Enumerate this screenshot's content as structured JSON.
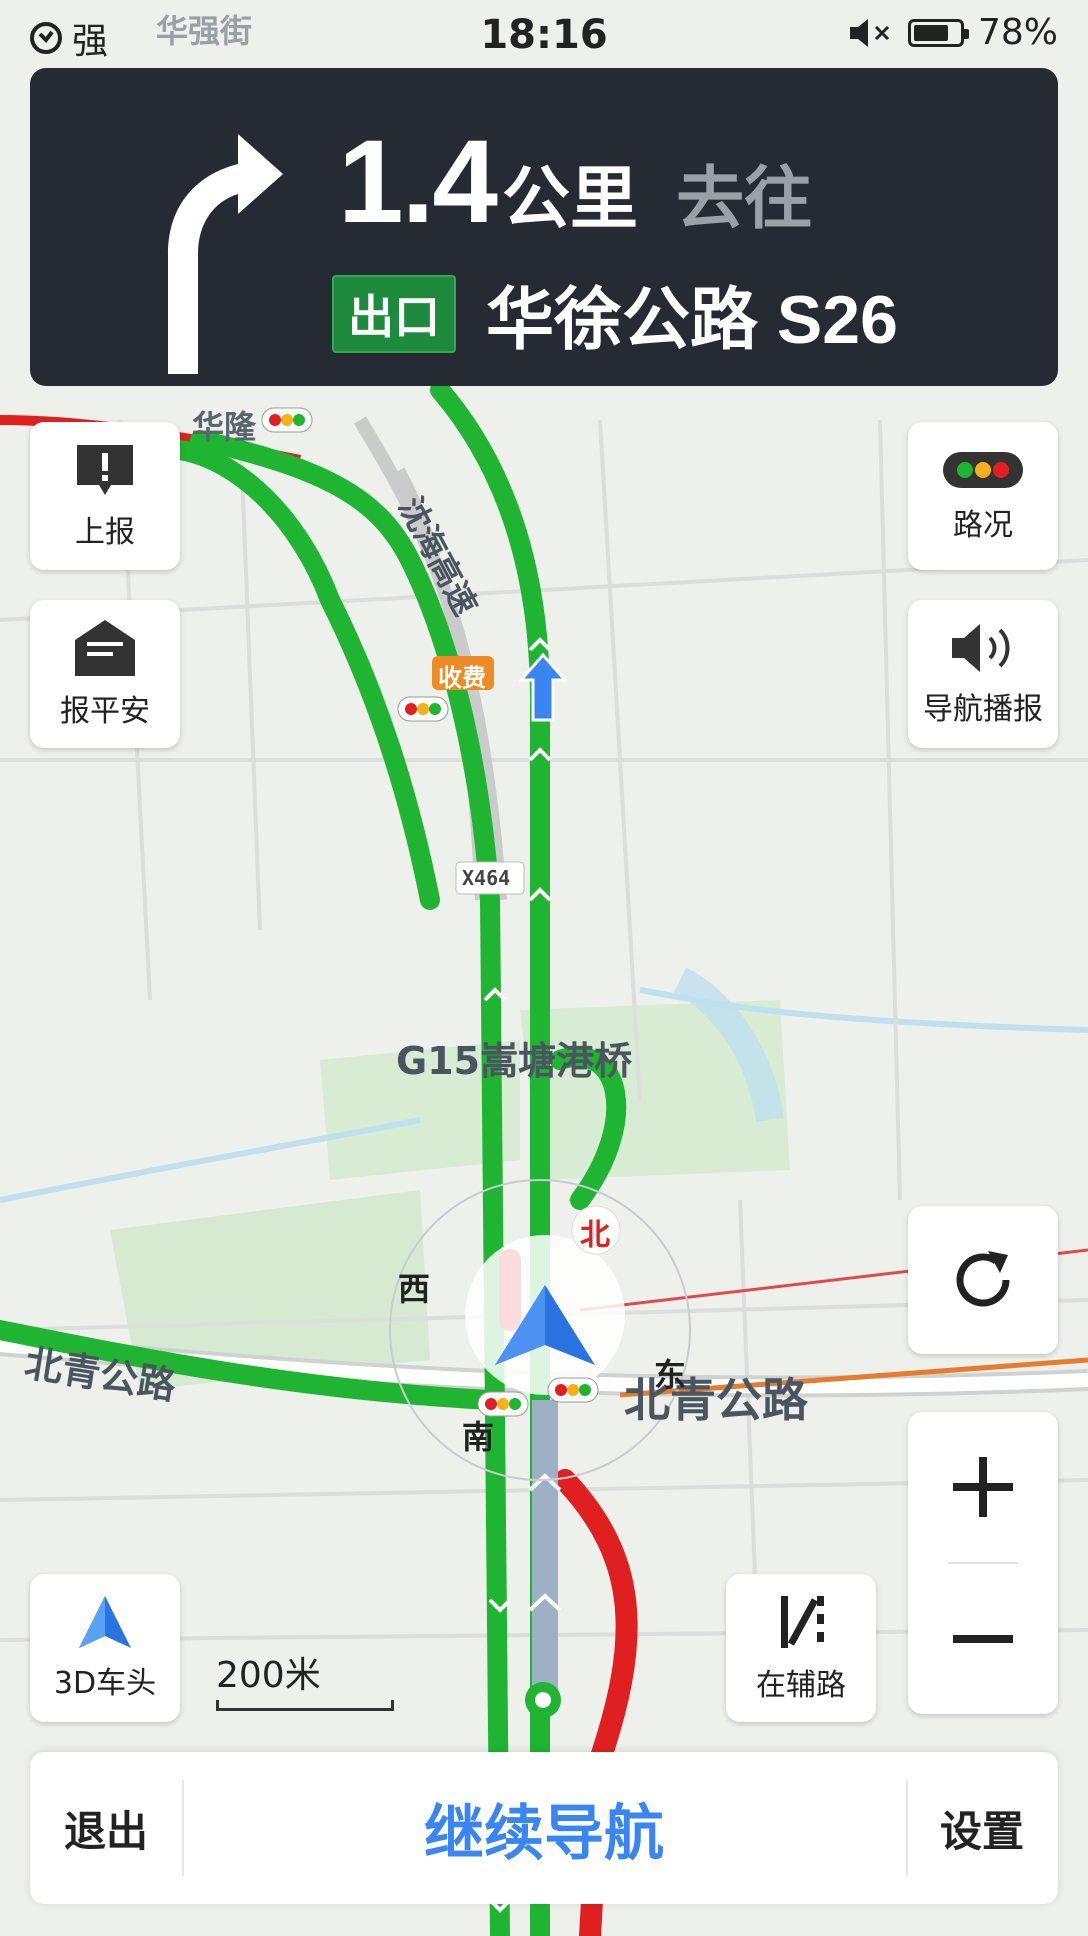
{
  "status_bar": {
    "signal_text": "强",
    "time": "18:16",
    "battery_percent": "78%",
    "battery_level": 0.78
  },
  "guidance": {
    "distance": "1.4",
    "unit": "公里",
    "toward": "去往",
    "exit_tag": "出口",
    "road_name": "华徐公路  S26",
    "maneuver_icon": "turn-slight-left-arrow"
  },
  "buttons": {
    "report": "上报",
    "safe": "报平安",
    "traffic": "路况",
    "voice": "导航播报",
    "view_3d": "3D车头",
    "aux_road": "在辅路"
  },
  "scale_label": "200米",
  "bottom_bar": {
    "exit": "退出",
    "continue": "继续导航",
    "settings": "设置"
  },
  "map_labels": {
    "street_top": "华强街",
    "hualong": "华隆",
    "shenhai": "沈海高速",
    "toll": "收费",
    "x464": "X464",
    "bridge": "G15嵩塘港桥",
    "beiqing_left": "北青公路",
    "beiqing_right": "北青公路",
    "compass_n": "北",
    "compass_w": "西",
    "compass_e": "东",
    "compass_s": "南"
  },
  "colors": {
    "traffic_green": "#1fb532",
    "traffic_red": "#e02020",
    "route_grey": "#9db0c6",
    "accent_blue": "#3a86f0",
    "panel_dark": "#252a33"
  }
}
